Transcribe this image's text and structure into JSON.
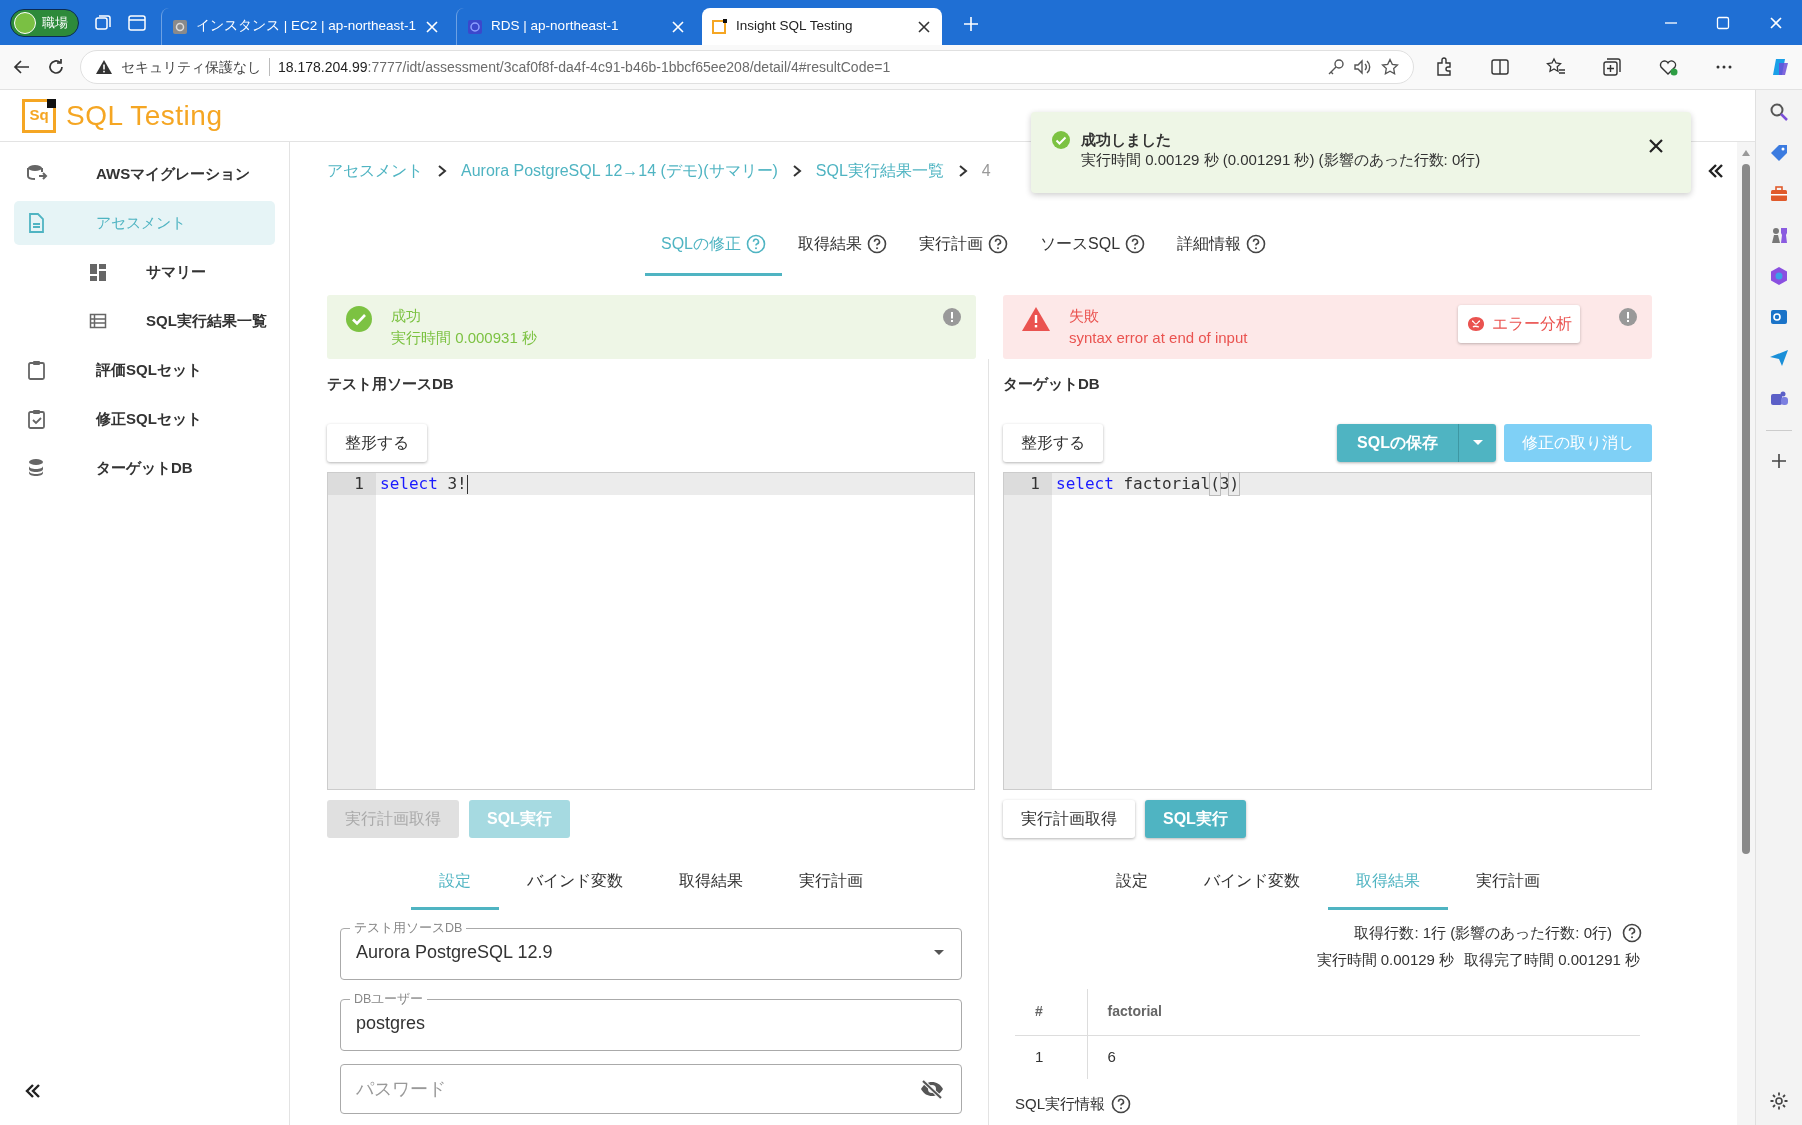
{
  "browser": {
    "profile": "職場",
    "tabs": [
      {
        "title": "インスタンス | EC2 | ap-northeast-1",
        "selected": false
      },
      {
        "title": "RDS | ap-northeast-1",
        "selected": false
      },
      {
        "title": "Insight SQL Testing",
        "selected": true
      }
    ],
    "address": {
      "security": "セキュリティ保護なし",
      "host": "18.178.204.99",
      "rest": ":7777/idt/assessment/3caf0f8f-da4f-4c91-b46b-1bbcf65ee208/detail/4#resultCode=1"
    }
  },
  "app": {
    "logo_mark": "Sq",
    "title": "SQL Testing"
  },
  "sidebar": {
    "items": [
      {
        "label": "AWSマイグレーション",
        "selected": false
      },
      {
        "label": "アセスメント",
        "selected": true,
        "children": [
          {
            "label": "サマリー",
            "selected": false
          },
          {
            "label": "SQL実行結果一覧",
            "selected": false
          }
        ]
      },
      {
        "label": "評価SQLセット",
        "selected": false
      },
      {
        "label": "修正SQLセット",
        "selected": false
      },
      {
        "label": "ターゲットDB",
        "selected": false
      }
    ]
  },
  "breadcrumb": [
    {
      "label": "アセスメント",
      "kind": "link"
    },
    {
      "label": "Aurora PostgreSQL 12→14 (デモ)(サマリー)",
      "kind": "link"
    },
    {
      "label": "SQL実行結果一覧",
      "kind": "link"
    },
    {
      "label": "4",
      "kind": "current"
    }
  ],
  "toast": {
    "title": "成功しました",
    "message": "実行時間 0.00129 秒 (0.001291 秒) (影響のあった行数: 0行)"
  },
  "tabs": [
    {
      "label": "SQLの修正",
      "selected": true
    },
    {
      "label": "取得結果",
      "selected": false
    },
    {
      "label": "実行計画",
      "selected": false
    },
    {
      "label": "ソースSQL",
      "selected": false
    },
    {
      "label": "詳細情報",
      "selected": false
    }
  ],
  "panels": [
    {
      "status": {
        "kind": "success",
        "title": "成功",
        "message": "実行時間 0.000931 秒"
      },
      "heading": "テスト用ソースDB",
      "toolbar": [
        {
          "label": "整形する",
          "kind": "white",
          "disabled": false
        }
      ],
      "editor": {
        "line": "1",
        "cursor": true,
        "tokens": [
          {
            "text": "select",
            "kind": "keyword"
          },
          {
            "text": " 3!",
            "kind": "plain"
          }
        ]
      },
      "buttons": [
        {
          "label": "実行計画取得",
          "kind": "white",
          "disabled": true
        },
        {
          "label": "SQL実行",
          "kind": "teal",
          "disabled": true
        }
      ],
      "subtabs": [
        {
          "label": "設定",
          "selected": true
        },
        {
          "label": "バインド変数",
          "selected": false
        },
        {
          "label": "取得結果",
          "selected": false
        },
        {
          "label": "実行計画",
          "selected": false
        }
      ],
      "fields": [
        {
          "kind": "select",
          "label": "テスト用ソースDB",
          "value": "Aurora PostgreSQL 12.9"
        },
        {
          "kind": "text",
          "label": "DBユーザー",
          "value": "postgres"
        },
        {
          "kind": "password",
          "placeholder": "パスワード"
        }
      ]
    },
    {
      "status": {
        "kind": "error",
        "title": "失敗",
        "message": "syntax error at end of input",
        "action": "エラー分析"
      },
      "heading": "ターゲットDB",
      "toolbar": [
        {
          "label": "整形する",
          "kind": "white",
          "disabled": false
        },
        {
          "label": "SQLの保存",
          "kind": "split",
          "disabled": false
        },
        {
          "label": "修正の取り消し",
          "kind": "light",
          "disabled": true
        }
      ],
      "editor": {
        "line": "1",
        "cursor": false,
        "tokens": [
          {
            "text": "select",
            "kind": "keyword"
          },
          {
            "text": " factorial",
            "kind": "plain"
          },
          {
            "text": "(",
            "kind": "bracket"
          },
          {
            "text": "3",
            "kind": "plain"
          },
          {
            "text": ")",
            "kind": "bracket"
          }
        ]
      },
      "buttons": [
        {
          "label": "実行計画取得",
          "kind": "white",
          "disabled": false
        },
        {
          "label": "SQL実行",
          "kind": "teal",
          "disabled": false
        }
      ],
      "subtabs": [
        {
          "label": "設定",
          "selected": false
        },
        {
          "label": "バインド変数",
          "selected": false
        },
        {
          "label": "取得結果",
          "selected": true
        },
        {
          "label": "実行計画",
          "selected": false
        }
      ],
      "result": {
        "summary": "取得行数: 1行 (影響のあった行数: 0行)",
        "timing": [
          "実行時間 0.00129 秒",
          "取得完了時間 0.001291 秒"
        ],
        "table": {
          "columns": [
            "#",
            "factorial"
          ],
          "rows": [
            [
              "1",
              "6"
            ]
          ]
        },
        "section": "SQL実行情報"
      }
    }
  ]
}
